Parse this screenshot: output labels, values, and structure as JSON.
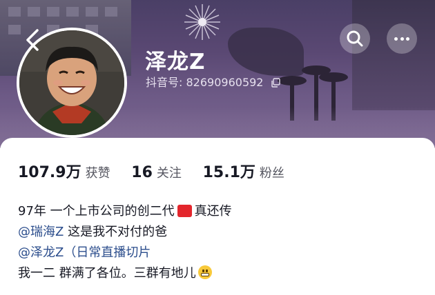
{
  "profile": {
    "name": "泽龙Z",
    "id_label": "抖音号:",
    "id_value": "82690960592"
  },
  "icons": {
    "back": "chevron-left-icon",
    "search": "search-icon",
    "more": "more-dots-icon",
    "copy": "copy-icon"
  },
  "stats": [
    {
      "value": "107.9万",
      "label": "获赞"
    },
    {
      "value": "16",
      "label": "关注"
    },
    {
      "value": "15.1万",
      "label": "粉丝"
    }
  ],
  "bio": {
    "line1_text": "97年 一个上市公司的创二代",
    "line1_after": "真还传",
    "line2_mention": "@瑞海Z",
    "line2_text": " 这是我不对付的爸",
    "line3_mention": "@泽龙Z（日常直播切片",
    "line4_text": "我一二 群满了各位。三群有地儿"
  },
  "colors": {
    "header_bg": "#5a4873",
    "mention": "#2b4d8c",
    "flag": "#e3262c"
  }
}
